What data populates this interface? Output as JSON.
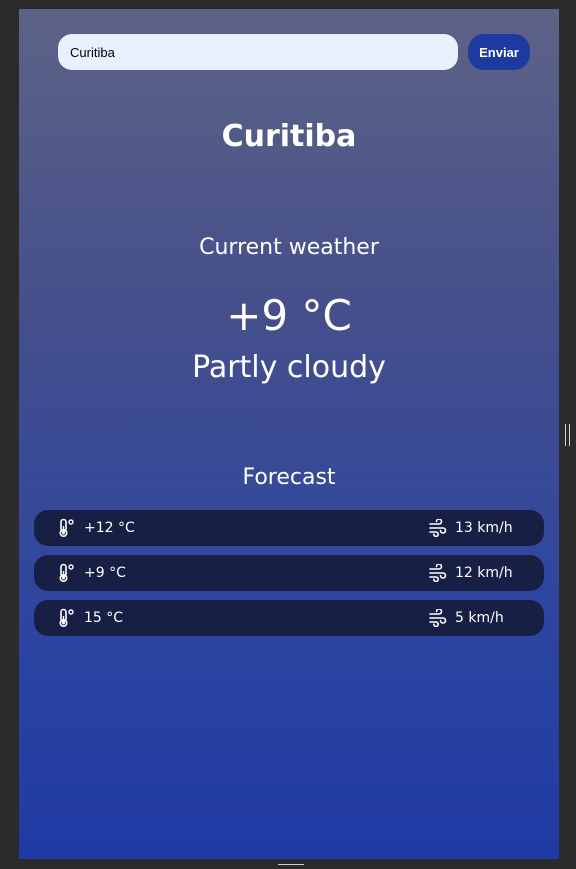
{
  "search": {
    "value": "Curitiba",
    "button_label": "Enviar"
  },
  "city": "Curitiba",
  "current": {
    "label": "Current weather",
    "temperature": "+9 °C",
    "description": "Partly cloudy"
  },
  "forecast": {
    "label": "Forecast",
    "items": [
      {
        "temperature": "+12 °C",
        "wind": "13 km/h"
      },
      {
        "temperature": "+9 °C",
        "wind": "12 km/h"
      },
      {
        "temperature": "15 °C",
        "wind": "5 km/h"
      }
    ]
  },
  "icons": {
    "temperature": "thermometer-icon",
    "wind": "wind-icon"
  },
  "colors": {
    "send_button": "#1c3aa0",
    "forecast_row": "#172044",
    "input_background": "#e8f0fe"
  }
}
